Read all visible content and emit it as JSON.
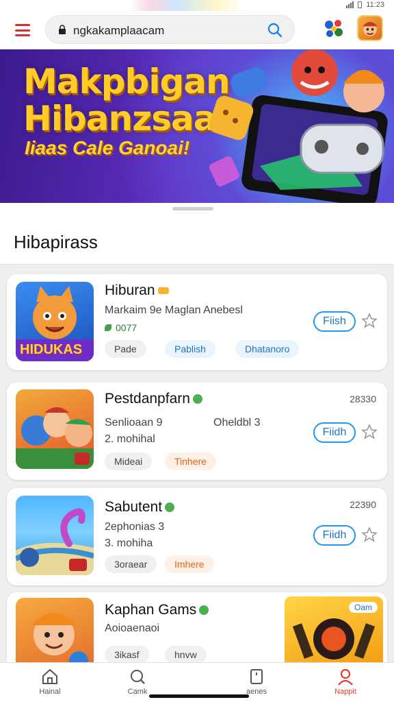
{
  "status_bar": {
    "time": "11:23"
  },
  "search": {
    "url": "ngkakamplaacam"
  },
  "banner": {
    "title_line1": "Makpbigan",
    "title_line2": "Hibanzsaa",
    "subtitle": "Iiaas Cale Ganoai!"
  },
  "section": {
    "title": "Hibapirass"
  },
  "games": [
    {
      "name": "Hiburan",
      "desc": "Markaim 9e Maglan Anebesl",
      "stat": "0077",
      "chips": [
        "Pade",
        "Pablish",
        "Dhatanoro"
      ],
      "action": "Fiish",
      "icon_label": "HIDUKAS"
    },
    {
      "name": "Pestdanpfarn",
      "count": "28330",
      "meta_left": "Senlioaan 9",
      "meta_right": "Oheldbl 3",
      "meta_second": "2. mohihal",
      "chips": [
        "Mideai",
        "Tinhere"
      ],
      "action": "Fiidh"
    },
    {
      "name": "Sabutent",
      "count": "22390",
      "meta_left": "2ephonias 3",
      "meta_second": "3. mohiha",
      "chips": [
        "3oraear",
        "Imhere"
      ],
      "action": "Fiidh"
    },
    {
      "name": "Kaphan Gams",
      "meta_left": "Aoioaenaoi",
      "chips": [
        "3ikasf",
        "hnvw"
      ],
      "promo_label": "Oam"
    }
  ],
  "nav": {
    "items": [
      "Hainal",
      "Camk",
      "",
      "aenes",
      "Nappit"
    ],
    "active_index": 4
  },
  "colors": {
    "accent": "#e53935",
    "primary_button": "#2196f3",
    "banner_title": "#ffcc2a"
  }
}
